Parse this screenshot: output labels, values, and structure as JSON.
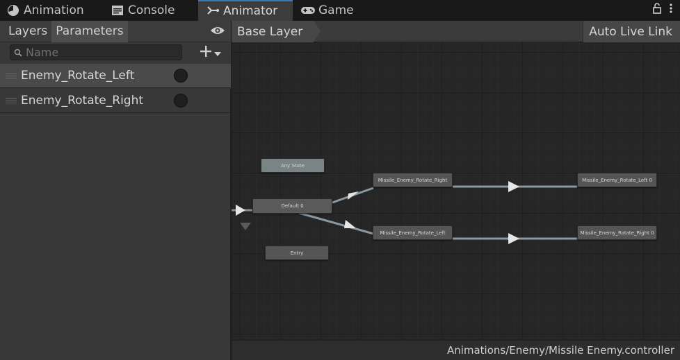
{
  "tabs": [
    {
      "label": "Animation",
      "icon": "clock-icon"
    },
    {
      "label": "Console",
      "icon": "console-icon"
    },
    {
      "label": "Animator",
      "icon": "animator-icon",
      "active": true
    },
    {
      "label": "Game",
      "icon": "gamepad-icon"
    }
  ],
  "tabbar_right": {
    "lock_icon": "lock-icon",
    "menu_icon": "kebab-menu-icon"
  },
  "left_panel": {
    "subtabs": [
      {
        "label": "Layers"
      },
      {
        "label": "Parameters",
        "selected": true
      }
    ],
    "eye_icon": "eye-icon",
    "search": {
      "placeholder": "Name",
      "value": ""
    },
    "add_icon": "plus-icon",
    "parameters": [
      {
        "name": "Enemy_Rotate_Left",
        "type": "trigger",
        "selected": true
      },
      {
        "name": "Enemy_Rotate_Right",
        "type": "trigger",
        "selected": false
      }
    ]
  },
  "graph": {
    "breadcrumb": "Base Layer",
    "auto_live_link": "Auto Live Link",
    "nodes": {
      "any_state": "Any State",
      "default": "Default 0",
      "entry": "Entry",
      "rotate_right": "Missile_Enemy_Rotate_Right",
      "rotate_left": "Missile_Enemy_Rotate_Left",
      "rotate_left_0": "Missile_Enemy_Rotate_Left 0",
      "rotate_right_0": "Missile_Enemy_Rotate_Right 0"
    },
    "status_path": "Animations/Enemy/Missile Enemy.controller"
  },
  "colors": {
    "active_tab_accent": "#3a79bb",
    "any_state_node": "#7b8484",
    "state_node": "#555555"
  }
}
